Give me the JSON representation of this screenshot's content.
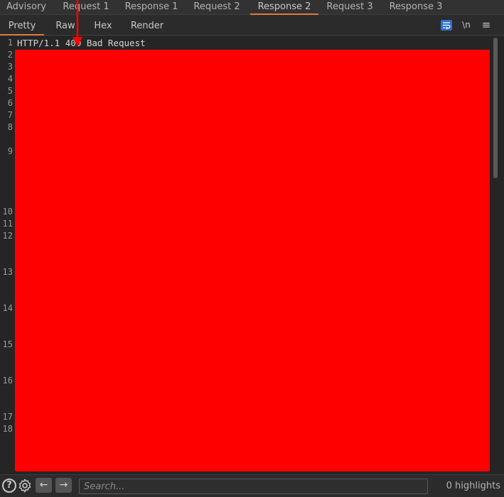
{
  "top_tabs": [
    {
      "label": "Advisory"
    },
    {
      "label": "Request 1"
    },
    {
      "label": "Response 1"
    },
    {
      "label": "Request 2"
    },
    {
      "label": "Response 2",
      "active": true
    },
    {
      "label": "Request 3"
    },
    {
      "label": "Response 3"
    }
  ],
  "sub_tabs": [
    {
      "label": "Pretty",
      "active": true
    },
    {
      "label": "Raw"
    },
    {
      "label": "Hex"
    },
    {
      "label": "Render"
    }
  ],
  "toolbar": {
    "newline_label": "\\n",
    "menu_label": "≡",
    "wrap_icon": "word-wrap-icon"
  },
  "editor": {
    "first_line": "HTTP/1.1 400 Bad Request",
    "line_numbers": [
      "1",
      "2",
      "3",
      "4",
      "5",
      "6",
      "7",
      "8",
      "9",
      "10",
      "11",
      "12",
      "13",
      "14",
      "15",
      "16",
      "17",
      "18"
    ],
    "redaction_color": "#ff0000"
  },
  "bottom": {
    "search_placeholder": "Search...",
    "highlights": "0 highlights",
    "back_arrow": "←",
    "forward_arrow": "→",
    "help_label": "?"
  },
  "colors": {
    "accent": "#e07a3f",
    "annotation_arrow": "#ff0000"
  }
}
